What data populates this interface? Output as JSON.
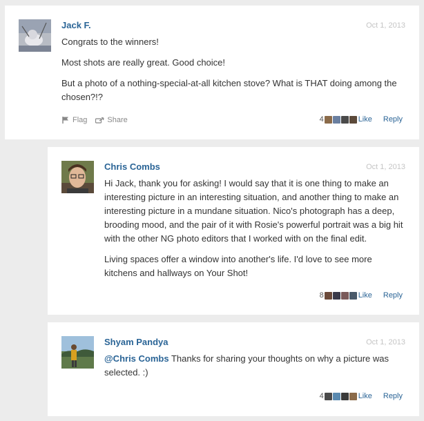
{
  "comments": [
    {
      "author": "Jack F.",
      "date": "Oct 1, 2013",
      "paragraphs": [
        "Congrats to the winners!",
        "Most shots are really great. Good choice!",
        "But a photo of a nothing-special-at-all kitchen stove? What is THAT doing among the chosen?!?"
      ],
      "flag_label": "Flag",
      "share_label": "Share",
      "like_count": "4",
      "like_label": "Like",
      "reply_label": "Reply",
      "liker_colors": [
        "#8b6b4a",
        "#6a7fa0",
        "#4a4a4a",
        "#5c4a3a"
      ]
    },
    {
      "author": "Chris Combs",
      "date": "Oct 1, 2013",
      "paragraphs": [
        "Hi Jack, thank you for asking! I would say that it is one thing to make an interesting picture in an interesting situation, and another thing to make an interesting picture in a mundane situation. Nico's photograph has a deep, brooding mood, and the pair of it with Rosie's powerful portrait was a big hit with the other NG photo editors that I worked with on the final edit.",
        "Living spaces offer a window into another's life. I'd love to see more kitchens and hallways on Your Shot!"
      ],
      "like_count": "8",
      "like_label": "Like",
      "reply_label": "Reply",
      "liker_colors": [
        "#6b4a3a",
        "#3a3a4a",
        "#7a5a5a",
        "#4a5a6a"
      ]
    },
    {
      "author": "Shyam Pandya",
      "date": "Oct 1, 2013",
      "mention": "@Chris Combs",
      "text": " Thanks for sharing your thoughts on why a picture was selected. :)",
      "like_count": "4",
      "like_label": "Like",
      "reply_label": "Reply",
      "liker_colors": [
        "#4a4a4a",
        "#5a8ab0",
        "#3a3a3a",
        "#8b6b4a"
      ]
    }
  ]
}
